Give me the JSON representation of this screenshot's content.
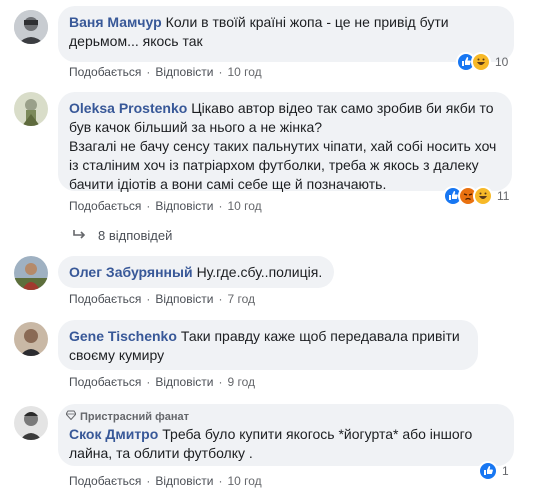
{
  "comments": [
    {
      "author": "Ваня Мамчур",
      "text": "Коли в твоїй країні жопа - це не привід бути дерьмом... якось так",
      "like": "Подобається",
      "reply": "Відповісти",
      "time": "10 год",
      "reaction_count": "10",
      "reaction_icons": [
        "like-icon",
        "haha-icon"
      ]
    },
    {
      "author": "Oleksa Prostenko",
      "text": "Цікаво автор відео так само зробив би якби то був качок більший за нього а не жінка?\nВзагалі не бачу сенсу таких пальнутих чіпати, хай собі носить хоч із сталіним хоч із патріархом футболки, треба ж якось з далеку бачити ідіотів а вони самі себе ще й позначають.",
      "like": "Подобається",
      "reply": "Відповісти",
      "time": "10 год",
      "reaction_count": "11",
      "reaction_icons": [
        "like-icon",
        "angry-icon",
        "haha-icon"
      ]
    },
    {
      "author": "Олег Забурянный",
      "text": "Ну.где.сбу..полиція.",
      "like": "Подобається",
      "reply": "Відповісти",
      "time": "7 год"
    },
    {
      "author": "Gene Tischenko",
      "text": "Таки правду каже щоб передавала привіти своєму кумиру",
      "like": "Подобається",
      "reply": "Відповісти",
      "time": "9 год"
    },
    {
      "badge": "Пристрасний фанат",
      "author": "Скок Дмитро",
      "text": "Треба було купити якогось *йогурта* або іншого лайна, та облити футболку .",
      "like": "Подобається",
      "reply": "Відповісти",
      "time": "10 год",
      "reaction_count": "1",
      "reaction_icons": [
        "like-icon"
      ]
    }
  ],
  "replies_link": "8 відповідей",
  "separator": "·",
  "colors": {
    "author": "#385898",
    "bubble": "#f0f2f5",
    "like_blue": "#1877f2",
    "haha_yellow": "#f7b928",
    "angry_orange": "#e9710f"
  }
}
